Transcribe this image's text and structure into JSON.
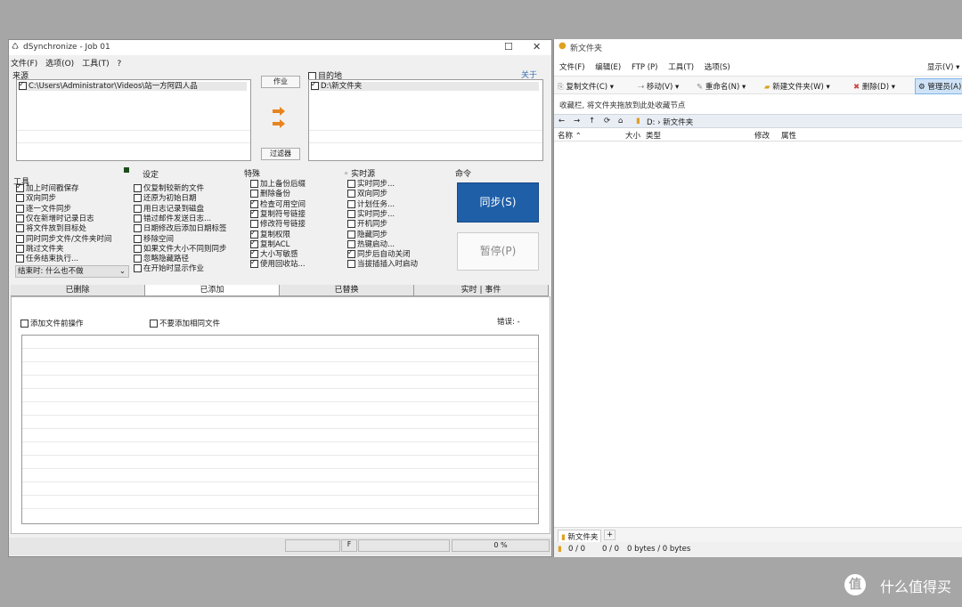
{
  "left": {
    "title": "dSynchronize - Job 01",
    "menu": [
      "文件(F)",
      "选项(O)",
      "工具(T)",
      "?"
    ],
    "source_label": "来源",
    "source_path": "C:\\Users\\Administrator\\Videos\\站一方阿四人品",
    "job_button": "作业",
    "filter_button": "过滤器",
    "dest_label": "目的地",
    "dest_path": "D:\\新文件夹",
    "about_link": "关于",
    "options_header": "工具",
    "options": [
      {
        "label": "加上时间戳保存",
        "checked": true
      },
      {
        "label": "双向同步",
        "checked": false
      },
      {
        "label": "逐一文件同步",
        "checked": false
      },
      {
        "label": "仅在新增时记录日志",
        "checked": false
      },
      {
        "label": "将文件放到目标处",
        "checked": false
      },
      {
        "label": "同时同步文件/文件夹时间",
        "checked": false
      },
      {
        "label": "跳过文件夹",
        "checked": false
      },
      {
        "label": "任务结束执行...",
        "checked": false
      }
    ],
    "after_select": "结束时: 什么也不做",
    "settings_header": "设定",
    "settings": [
      {
        "label": "仅复制较新的文件",
        "checked": false
      },
      {
        "label": "还原为初始日期",
        "checked": false
      },
      {
        "label": "用日志记录到磁盘",
        "checked": false
      },
      {
        "label": "错过邮件发送日志...",
        "checked": false
      },
      {
        "label": "日期修改后添加日期标签",
        "checked": false
      },
      {
        "label": "移除空间",
        "checked": false
      },
      {
        "label": "如果文件大小不同则同步",
        "checked": false
      },
      {
        "label": "忽略隐藏路径",
        "checked": false
      },
      {
        "label": "在开始时显示作业",
        "checked": false
      }
    ],
    "special_header": "特殊",
    "special": [
      {
        "label": "加上备份后缀",
        "checked": false
      },
      {
        "label": "删除备份",
        "checked": false
      },
      {
        "label": "检查可用空间",
        "checked": true
      },
      {
        "label": "复制符号链接",
        "checked": true
      },
      {
        "label": "修改符号链接",
        "checked": false
      },
      {
        "label": "复制权限",
        "checked": true
      },
      {
        "label": "复制ACL",
        "checked": true
      },
      {
        "label": "大小写敏感",
        "checked": true
      },
      {
        "label": "使用回收站...",
        "checked": true
      }
    ],
    "realtime_header": "实时源",
    "realtime": [
      {
        "label": "实时同步...",
        "checked": false
      },
      {
        "label": "双向同步",
        "checked": false
      },
      {
        "label": "计划任务...",
        "checked": false
      },
      {
        "label": "实时同步...",
        "checked": false
      },
      {
        "label": "开机同步",
        "checked": false
      },
      {
        "label": "隐藏同步",
        "checked": false
      },
      {
        "label": "热键启动...",
        "checked": false
      },
      {
        "label": "同步后自动关闭",
        "checked": true
      },
      {
        "label": "当拔插插入时启动",
        "checked": false
      }
    ],
    "command_header": "命令",
    "sync_button": "同步(S)",
    "pause_button": "暂停(P)",
    "tabs": [
      "已删除",
      "已添加",
      "已替换",
      "实时 | 事件"
    ],
    "added_checkbox": "添加文件前操作",
    "no_add_checkbox": "不要添加相同文件",
    "errors_label": "错误: -",
    "status_letter": "F",
    "progress_text": "0 %"
  },
  "right": {
    "title": "新文件夹",
    "menu": [
      "文件(F)",
      "编辑(E)",
      "FTP (P)",
      "工具(T)",
      "选项(S)"
    ],
    "view_menu": "显示(V)",
    "toolbar": [
      "复制文件(C)",
      "移动(V)",
      "重命名(N)",
      "新建文件夹(W)",
      "删除(D)",
      "管理员(A)"
    ],
    "hint": "收藏栏, 将文件夹拖放到此处收藏节点",
    "path": "D: › 新文件夹",
    "columns": [
      "名称",
      "大小",
      "类型",
      "修改",
      "属性"
    ],
    "tab_name": "新文件夹",
    "status": [
      "0 / 0",
      "0 / 0",
      "0 bytes / 0 bytes"
    ]
  },
  "watermark": "什么值得买"
}
